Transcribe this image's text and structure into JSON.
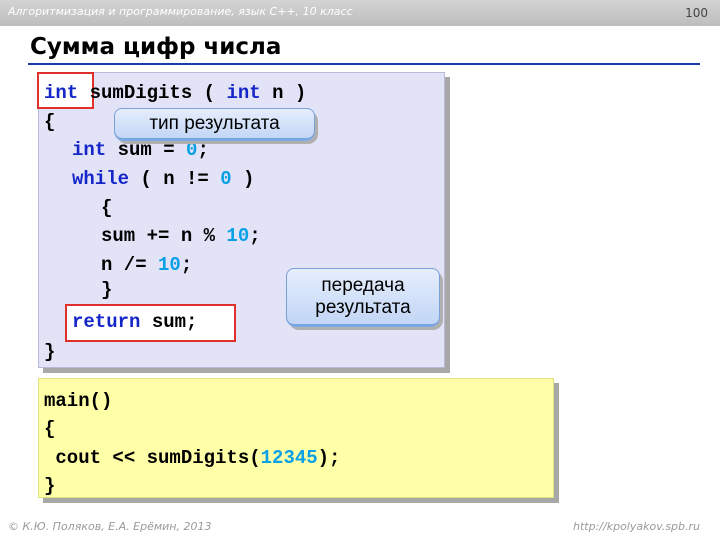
{
  "header": {
    "text": "Алгоритмизация и программирование, язык C++, 10 класс",
    "page_number": "100"
  },
  "title": "Сумма цифр числа",
  "func_code": {
    "kw_int": "int",
    "fn_sig": " sumDigits ( ",
    "kw_int2": "int",
    "param": " n )",
    "open_brace": "{",
    "sum_decl_kw": "int",
    "sum_decl_rest": " sum = ",
    "zero": "0",
    "semicolon": ";",
    "while_kw": "while",
    "while_cond": " ( n != ",
    "while_zero": "0",
    "while_close": " )",
    "inner_open": "{",
    "sum_update": "sum += n % ",
    "ten": "10",
    "sum_update_end": ";",
    "n_div": "n /= ",
    "ten2": "10",
    "n_div_end": ";",
    "inner_close": "}",
    "return_kw": "return",
    "return_rest": " sum;",
    "close_brace": "}"
  },
  "main_code": {
    "main_sig": "main()",
    "open_brace": "{",
    "cout_stmt": " cout << sumDigits(",
    "arg": "12345",
    "cout_end": ");",
    "close_brace": "}"
  },
  "callouts": {
    "return_type": "тип результата",
    "return_pass_line1": "передача",
    "return_pass_line2": "результата"
  },
  "footer": {
    "left": "© К.Ю. Поляков, Е.А. Ерёмин, 2013",
    "right": "http://kpolyakov.spb.ru"
  },
  "colors": {
    "keyword": "#1526c9",
    "number": "#0aa0e6",
    "highlight_border": "#e0302c",
    "func_box_bg": "#e3e3f8",
    "main_box_bg": "#ffffa8",
    "title_rule": "#1c3cad"
  }
}
